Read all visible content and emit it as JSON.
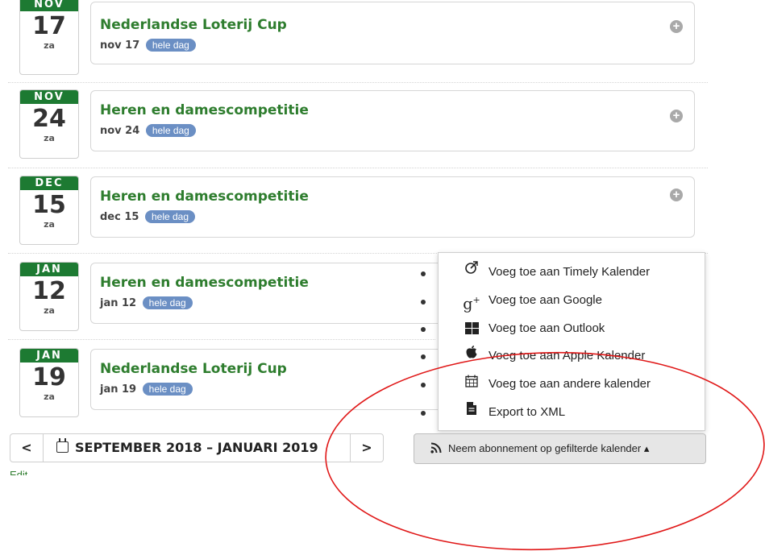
{
  "events": [
    {
      "month": "NOV",
      "day": "17",
      "weekday": "za",
      "title": "Nederlandse Loterij Cup",
      "date_text": "nov 17",
      "badge": "hele dag"
    },
    {
      "month": "NOV",
      "day": "24",
      "weekday": "za",
      "title": "Heren en damescompetitie",
      "date_text": "nov 24",
      "badge": "hele dag"
    },
    {
      "month": "DEC",
      "day": "15",
      "weekday": "za",
      "title": "Heren en damescompetitie",
      "date_text": "dec 15",
      "badge": "hele dag"
    },
    {
      "month": "JAN",
      "day": "12",
      "weekday": "za",
      "title": "Heren en damescompetitie",
      "date_text": "jan 12",
      "badge": "hele dag"
    },
    {
      "month": "JAN",
      "day": "19",
      "weekday": "za",
      "title": "Nederlandse Loterij Cup",
      "date_text": "jan 19",
      "badge": "hele dag"
    }
  ],
  "nav": {
    "prev_symbol": "<",
    "range_label": "SEPTEMBER 2018 – JANUARI 2019",
    "next_symbol": ">"
  },
  "subscribe": {
    "label": "Neem abonnement op gefilterde kalender ▴"
  },
  "edit_link": "Edit",
  "dropdown": {
    "items": [
      {
        "icon": "timely-icon",
        "label": "Voeg toe aan Timely Kalender"
      },
      {
        "icon": "google-plus-icon",
        "label": "Voeg toe aan Google"
      },
      {
        "icon": "windows-icon",
        "label": "Voeg toe aan Outlook"
      },
      {
        "icon": "apple-icon",
        "label": "Voeg toe aan Apple Kalender"
      },
      {
        "icon": "calendar-grid-icon",
        "label": "Voeg toe aan andere kalender"
      },
      {
        "icon": "file-icon",
        "label": "Export to XML"
      }
    ]
  },
  "colors": {
    "accent": "#1d7a32",
    "title": "#2e7d2e",
    "badge": "#6b8fc4",
    "annotation": "#e01818"
  }
}
